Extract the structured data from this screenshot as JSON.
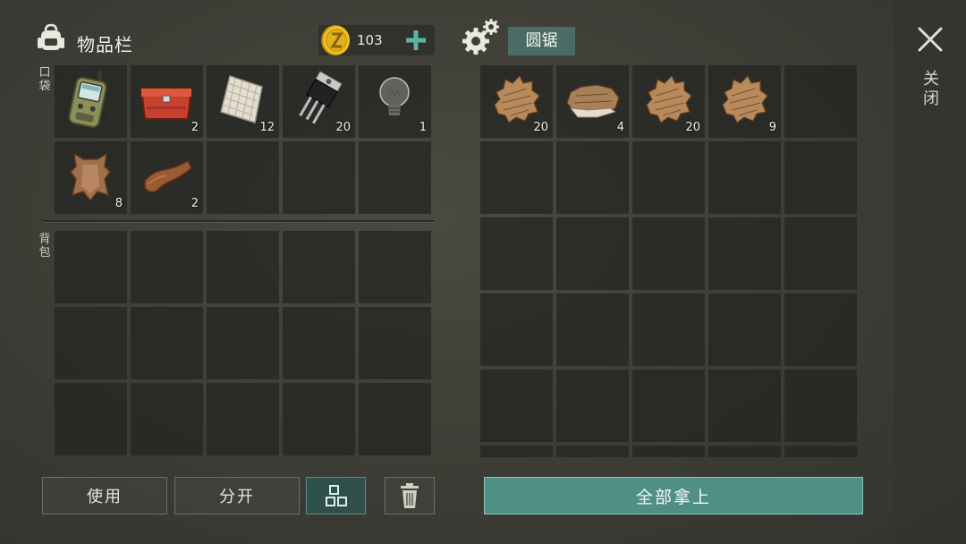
{
  "inventory": {
    "title": "物品栏",
    "coins": "103",
    "pocket_label": "口袋",
    "backpack_label": "背包",
    "pocket_slots": [
      {
        "item": "walkie-talkie",
        "qty": ""
      },
      {
        "item": "toolbox",
        "qty": "2"
      },
      {
        "item": "cloth",
        "qty": "12"
      },
      {
        "item": "transistor",
        "qty": "20"
      },
      {
        "item": "light-bulb",
        "qty": "1"
      },
      {
        "item": "animal-hide",
        "qty": "8"
      },
      {
        "item": "leather",
        "qty": "2"
      },
      {
        "item": "",
        "qty": ""
      },
      {
        "item": "",
        "qty": ""
      },
      {
        "item": "",
        "qty": ""
      }
    ]
  },
  "station": {
    "label": "圆锯",
    "slots": [
      {
        "item": "fur",
        "qty": "20"
      },
      {
        "item": "fur-pile",
        "qty": "4"
      },
      {
        "item": "fur",
        "qty": "20"
      },
      {
        "item": "fur",
        "qty": "9"
      }
    ]
  },
  "close_label": "关闭",
  "buttons": {
    "use": "使用",
    "split": "分开",
    "take_all": "全部拿上"
  },
  "colors": {
    "accent": "#4f8f86",
    "label_bg": "#4b6b66",
    "coin": "#e2b21f"
  }
}
